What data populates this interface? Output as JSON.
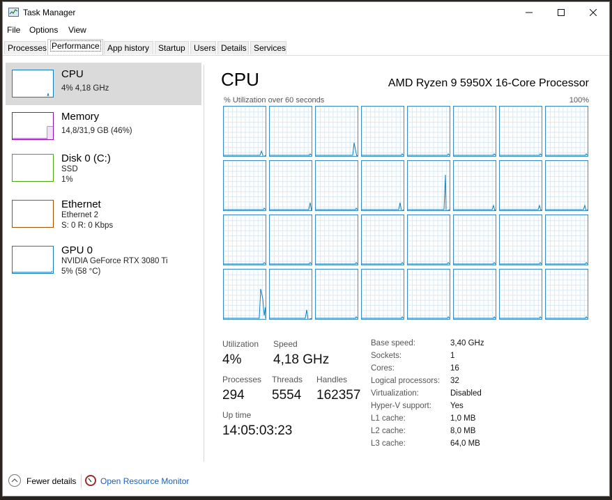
{
  "window": {
    "title": "Task Manager"
  },
  "menu": [
    "File",
    "Options",
    "View"
  ],
  "tabs": [
    "Processes",
    "Performance",
    "App history",
    "Startup",
    "Users",
    "Details",
    "Services"
  ],
  "active_tab": "Performance",
  "sidebar": [
    {
      "title": "CPU",
      "lines": [
        "4% 4,18 GHz"
      ],
      "color": "#117dbb",
      "selected": true,
      "icon": "cpu-thumbnail"
    },
    {
      "title": "Memory",
      "lines": [
        "14,8/31,9 GB (46%)"
      ],
      "color": "#8b12ae",
      "selected": false,
      "icon": "memory-thumbnail"
    },
    {
      "title": "Disk 0 (C:)",
      "lines": [
        "SSD",
        "1%"
      ],
      "color": "#4da60c",
      "selected": false,
      "icon": "disk-thumbnail"
    },
    {
      "title": "Ethernet",
      "lines": [
        "Ethernet 2",
        "S: 0 R: 0 Kbps"
      ],
      "color": "#a74f01",
      "selected": false,
      "icon": "ethernet-thumbnail"
    },
    {
      "title": "GPU 0",
      "lines": [
        "NVIDIA GeForce RTX 3080 Ti",
        "5% (58 °C)"
      ],
      "color": "#117dbb",
      "selected": false,
      "icon": "gpu-thumbnail"
    }
  ],
  "cpu": {
    "title": "CPU",
    "processor": "AMD Ryzen 9 5950X 16-Core Processor",
    "graph_label": "% Utilization over 60 seconds",
    "graph_max": "100%",
    "graph_color": "#117dbb",
    "core_count": 32
  },
  "stats": {
    "utilization": {
      "label": "Utilization",
      "value": "4%"
    },
    "speed": {
      "label": "Speed",
      "value": "4,18 GHz"
    },
    "processes": {
      "label": "Processes",
      "value": "294"
    },
    "threads": {
      "label": "Threads",
      "value": "5554"
    },
    "handles": {
      "label": "Handles",
      "value": "162357"
    },
    "uptime": {
      "label": "Up time",
      "value": "14:05:03:23"
    }
  },
  "specs": [
    {
      "key": "Base speed:",
      "value": "3,40 GHz"
    },
    {
      "key": "Sockets:",
      "value": "1"
    },
    {
      "key": "Cores:",
      "value": "16"
    },
    {
      "key": "Logical processors:",
      "value": "32"
    },
    {
      "key": "Virtualization:",
      "value": "Disabled"
    },
    {
      "key": "Hyper-V support:",
      "value": "Yes"
    },
    {
      "key": "L1 cache:",
      "value": "1,0 MB"
    },
    {
      "key": "L2 cache:",
      "value": "8,0 MB"
    },
    {
      "key": "L3 cache:",
      "value": "64,0 MB"
    }
  ],
  "footer": {
    "fewer_details": "Fewer details",
    "resource_monitor": "Open Resource Monitor"
  }
}
